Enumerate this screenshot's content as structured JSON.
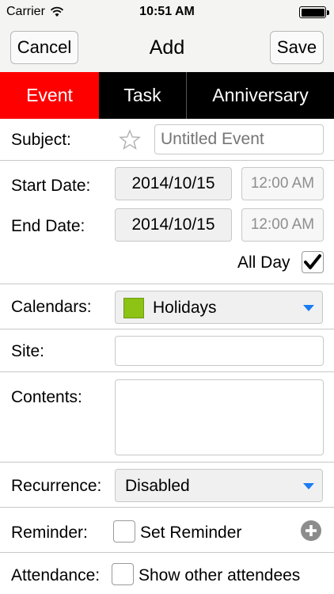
{
  "status_bar": {
    "carrier": "Carrier",
    "time": "10:51 AM",
    "wifi_icon": "wifi-icon",
    "battery_icon": "battery-icon"
  },
  "nav": {
    "cancel_label": "Cancel",
    "title": "Add",
    "save_label": "Save"
  },
  "tabs": [
    {
      "label": "Event",
      "selected": true
    },
    {
      "label": "Task",
      "selected": false
    },
    {
      "label": "Anniversary",
      "selected": false
    }
  ],
  "colors": {
    "selected_tab": "#ff0000",
    "tab_bar": "#000000",
    "calendar_swatch": "#8cc315",
    "dropdown_caret": "#1a7cf2"
  },
  "form": {
    "subject": {
      "label": "Subject:",
      "placeholder": "Untitled Event",
      "value": "",
      "star_icon": "star-outline-icon"
    },
    "start_date": {
      "label": "Start Date:",
      "date": "2014/10/15",
      "time": "12:00 AM"
    },
    "end_date": {
      "label": "End Date:",
      "date": "2014/10/15",
      "time": "12:00 AM"
    },
    "all_day": {
      "label": "All Day",
      "checked": true
    },
    "calendars": {
      "label": "Calendars:",
      "value": "Holidays"
    },
    "site": {
      "label": "Site:",
      "value": ""
    },
    "contents": {
      "label": "Contents:",
      "value": ""
    },
    "recurrence": {
      "label": "Recurrence:",
      "value": "Disabled"
    },
    "reminder": {
      "label": "Reminder:",
      "checkbox_label": "Set Reminder",
      "checked": false,
      "add_icon": "plus-circle-icon"
    },
    "attendance": {
      "label": "Attendance:",
      "checkbox_label": "Show other attendees",
      "checked": false
    }
  }
}
